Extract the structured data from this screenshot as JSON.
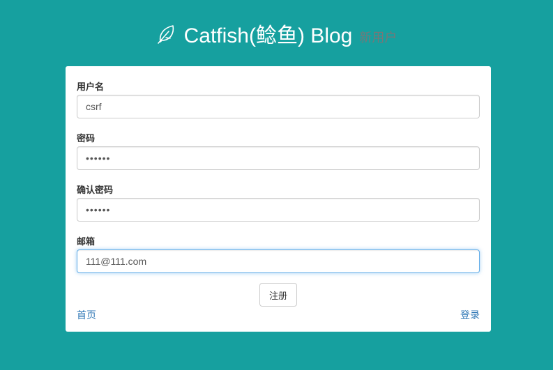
{
  "header": {
    "title": "Catfish(鲶鱼) Blog",
    "subtitle": "新用户",
    "logo_icon": "leaf-icon"
  },
  "form": {
    "username": {
      "label": "用户名",
      "value": "csrf"
    },
    "password": {
      "label": "密码",
      "value": "••••••"
    },
    "confirm_password": {
      "label": "确认密码",
      "value": "••••••"
    },
    "email": {
      "label": "邮箱",
      "value": "111@111.com"
    },
    "submit_label": "注册"
  },
  "footer": {
    "home_link": "首页",
    "login_link": "登录"
  },
  "colors": {
    "background": "#16a09f",
    "card": "#ffffff",
    "link": "#337ab7",
    "focus": "#66afe9"
  }
}
